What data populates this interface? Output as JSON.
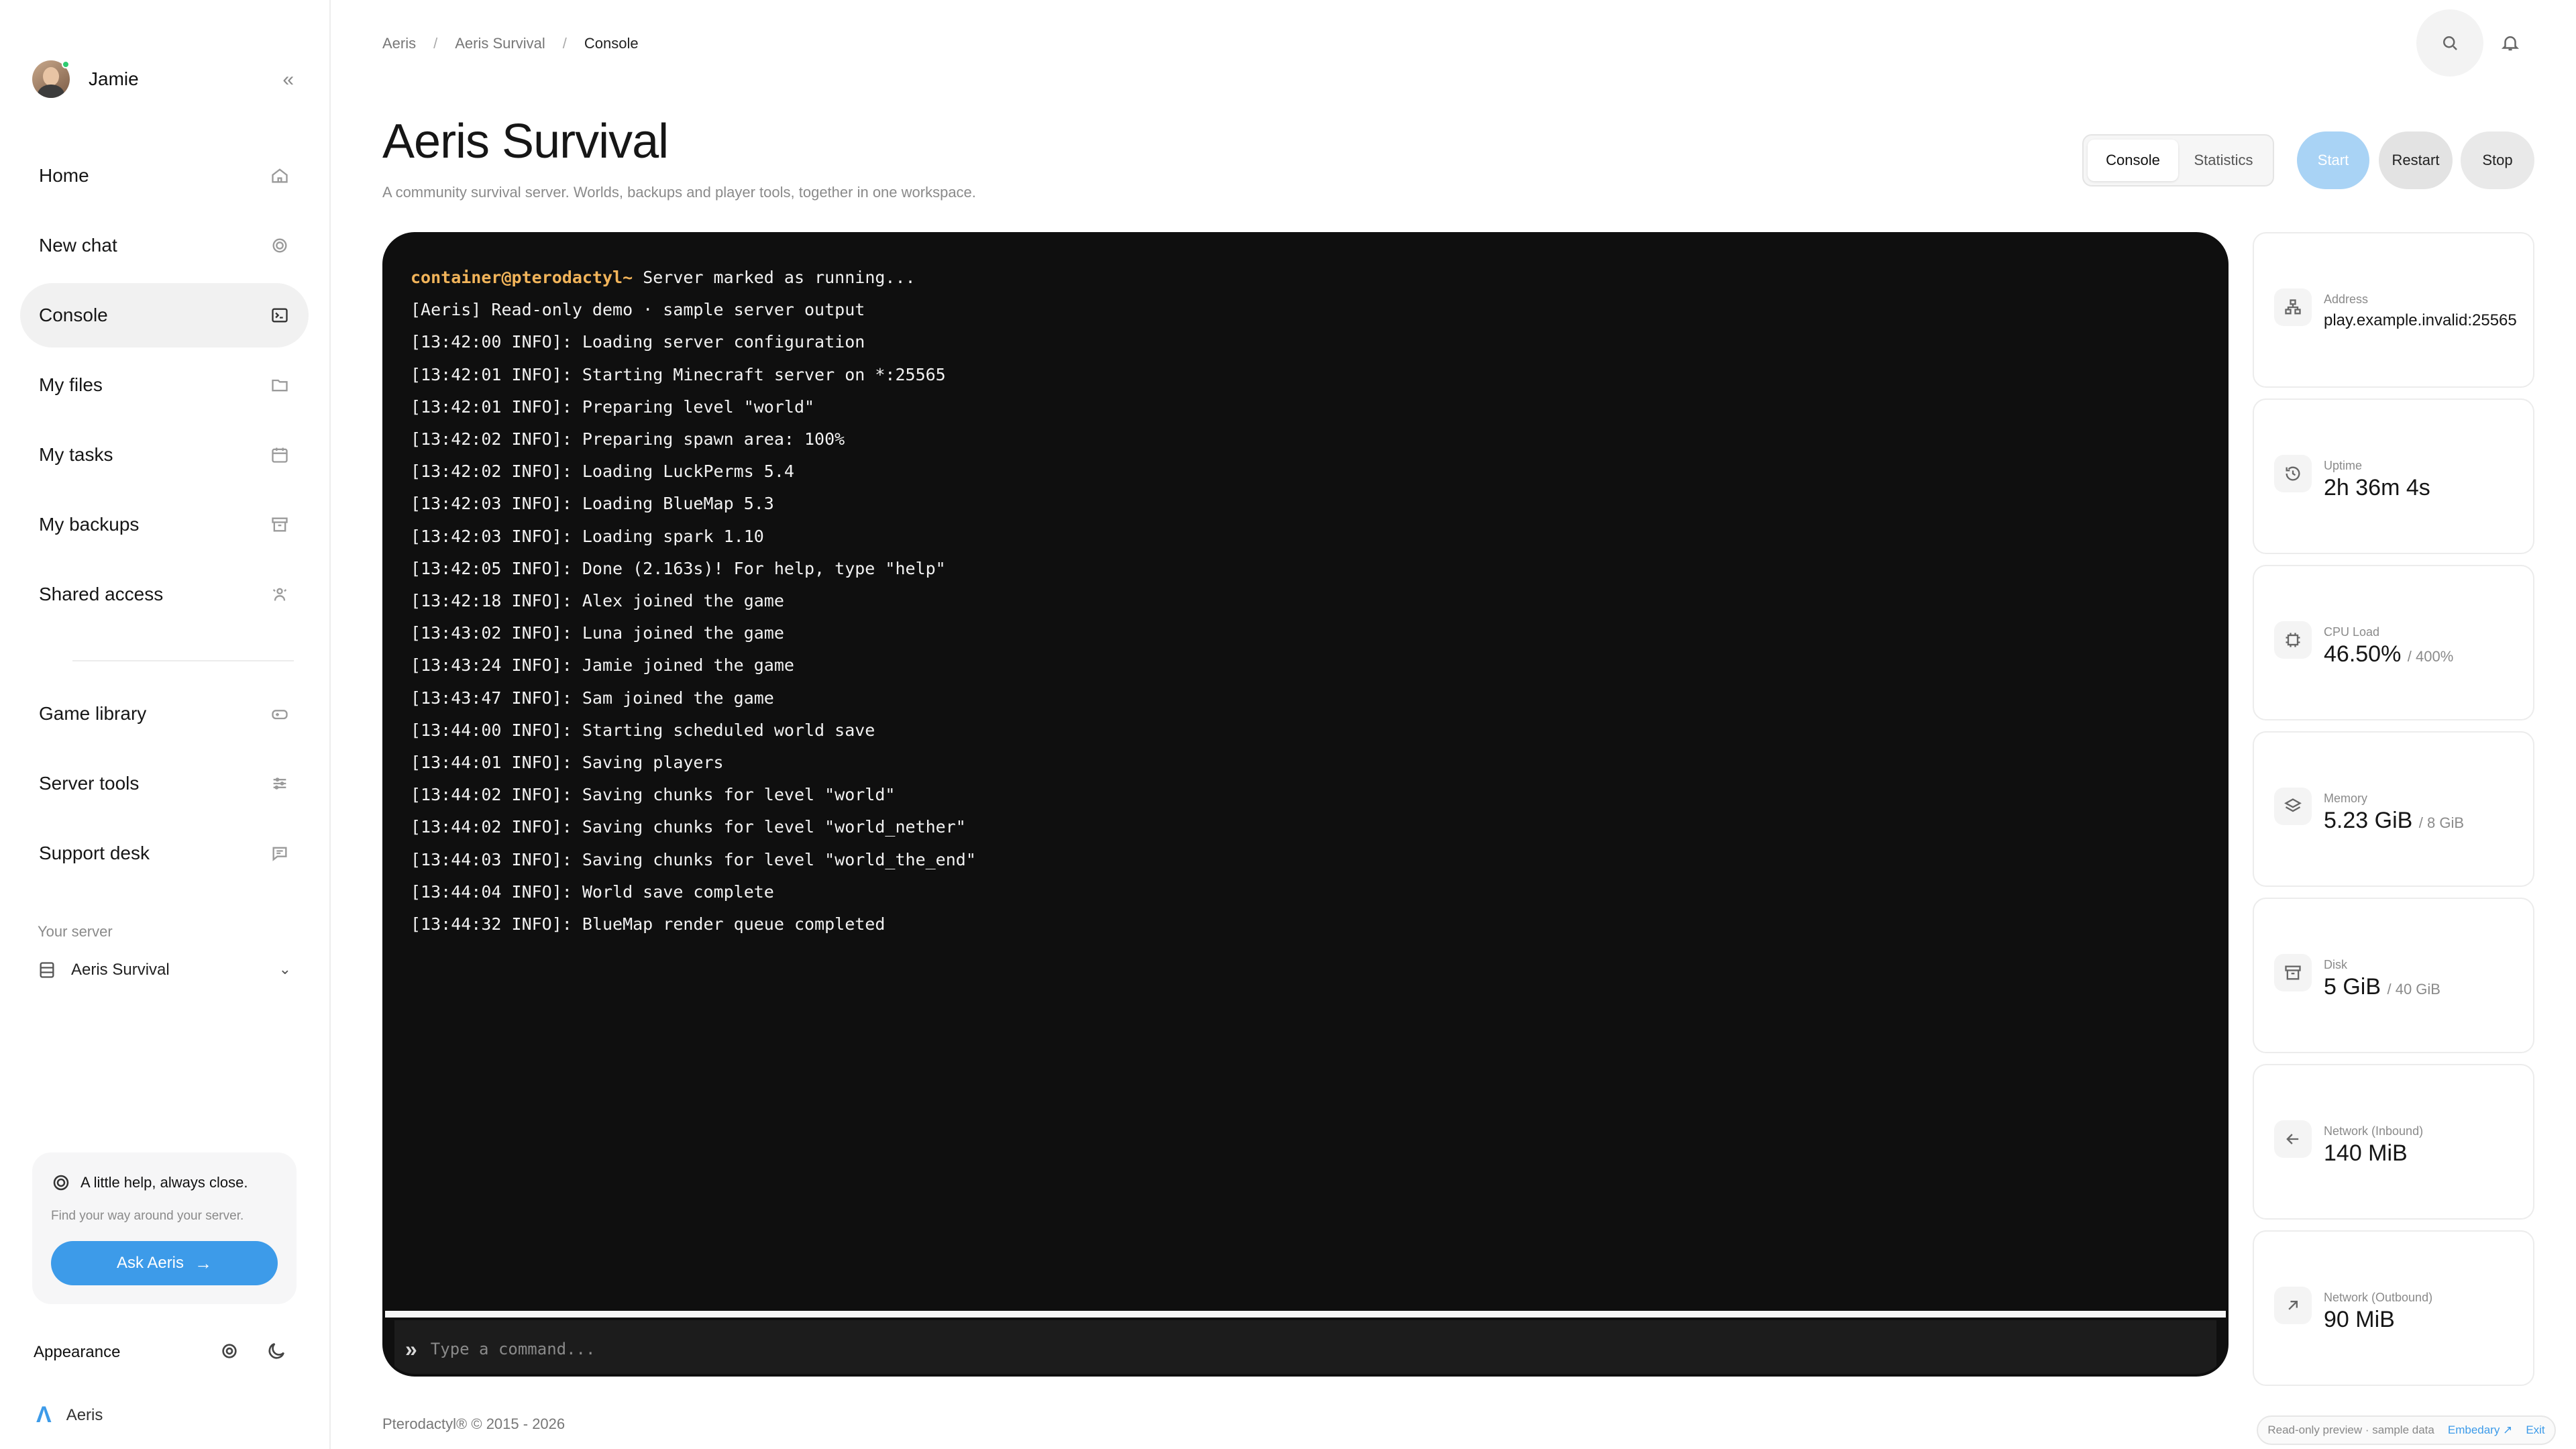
{
  "user": {
    "name": "Jamie"
  },
  "nav": {
    "primary": [
      {
        "label": "Home",
        "icon": "home-icon"
      },
      {
        "label": "New chat",
        "icon": "chat-icon"
      },
      {
        "label": "Console",
        "icon": "terminal-icon",
        "active": true
      },
      {
        "label": "My files",
        "icon": "folder-icon"
      },
      {
        "label": "My tasks",
        "icon": "calendar-icon"
      },
      {
        "label": "My backups",
        "icon": "archive-icon"
      },
      {
        "label": "Shared access",
        "icon": "users-icon"
      }
    ],
    "secondary": [
      {
        "label": "Game library",
        "icon": "gamepad-icon"
      },
      {
        "label": "Server tools",
        "icon": "sliders-icon"
      },
      {
        "label": "Support desk",
        "icon": "message-icon"
      }
    ]
  },
  "server_select": {
    "label": "Your server",
    "value": "Aeris Survival"
  },
  "help_card": {
    "title": "A little help, always close.",
    "subtitle": "Find your way around your server.",
    "button": "Ask Aeris"
  },
  "appearance": {
    "label": "Appearance"
  },
  "brand": {
    "name": "Aeris"
  },
  "breadcrumb": [
    "Aeris",
    "Aeris Survival",
    "Console"
  ],
  "page": {
    "title": "Aeris Survival",
    "subtitle": "A community survival server. Worlds, backups and player tools, together in one workspace."
  },
  "tabs": [
    "Console",
    "Statistics"
  ],
  "actions": {
    "start": "Start",
    "restart": "Restart",
    "stop": "Stop"
  },
  "console": {
    "prompt": "container@pterodactyl~",
    "first_line": " Server marked as running...",
    "lines": [
      "[Aeris] Read-only demo · sample server output",
      "[13:42:00 INFO]: Loading server configuration",
      "[13:42:01 INFO]: Starting Minecraft server on *:25565",
      "[13:42:01 INFO]: Preparing level \"world\"",
      "[13:42:02 INFO]: Preparing spawn area: 100%",
      "[13:42:02 INFO]: Loading LuckPerms 5.4",
      "[13:42:03 INFO]: Loading BlueMap 5.3",
      "[13:42:03 INFO]: Loading spark 1.10",
      "[13:42:05 INFO]: Done (2.163s)! For help, type \"help\"",
      "[13:42:18 INFO]: Alex joined the game",
      "[13:43:02 INFO]: Luna joined the game",
      "[13:43:24 INFO]: Jamie joined the game",
      "[13:43:47 INFO]: Sam joined the game",
      "[13:44:00 INFO]: Starting scheduled world save",
      "[13:44:01 INFO]: Saving players",
      "[13:44:02 INFO]: Saving chunks for level \"world\"",
      "[13:44:02 INFO]: Saving chunks for level \"world_nether\"",
      "[13:44:03 INFO]: Saving chunks for level \"world_the_end\"",
      "[13:44:04 INFO]: World save complete",
      "[13:44:32 INFO]: BlueMap render queue completed"
    ],
    "input_placeholder": "Type a command..."
  },
  "stats": [
    {
      "label": "Address",
      "value": "play.example.invalid:25565",
      "limit": "",
      "icon": "network-icon"
    },
    {
      "label": "Uptime",
      "value": "2h 36m 4s",
      "limit": "",
      "icon": "history-icon"
    },
    {
      "label": "CPU Load",
      "value": "46.50%",
      "limit": "/ 400%",
      "icon": "cpu-icon"
    },
    {
      "label": "Memory",
      "value": "5.23 GiB",
      "limit": "/ 8 GiB",
      "icon": "layers-icon"
    },
    {
      "label": "Disk",
      "value": "5 GiB",
      "limit": "/ 40 GiB",
      "icon": "archive-icon"
    },
    {
      "label": "Network (Inbound)",
      "value": "140 MiB",
      "limit": "",
      "icon": "arrow-left-icon"
    },
    {
      "label": "Network (Outbound)",
      "value": "90 MiB",
      "limit": "",
      "icon": "arrow-up-right-icon"
    }
  ],
  "footer": {
    "copyright": "Pterodactyl® © 2015 - 2026",
    "preview": "Read-only preview · sample data",
    "link": "Embedary ↗",
    "exit": "Exit"
  },
  "colors": {
    "accent": "#3d9be9",
    "prompt": "#f2b45a",
    "console_bg": "#0f0f0f"
  }
}
